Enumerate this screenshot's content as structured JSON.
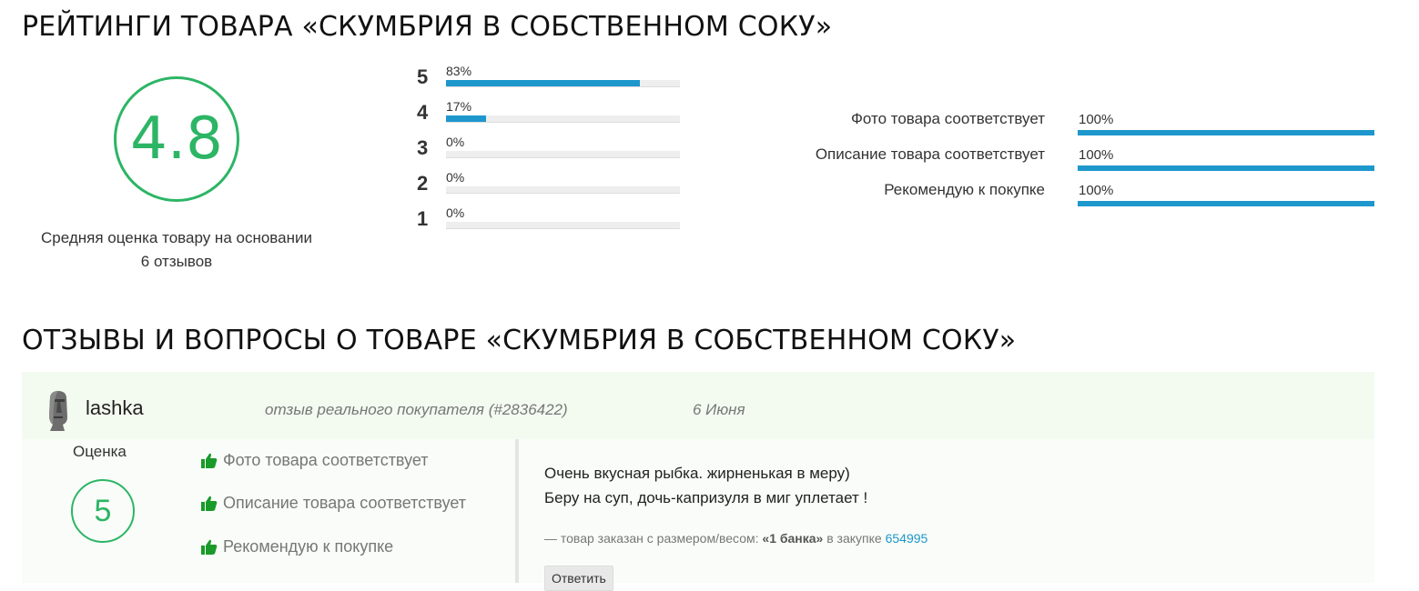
{
  "ratings": {
    "title": "РЕЙТИНГИ ТОВАРА «СКУМБРИЯ В СОБСТВЕННОМ СОКУ»",
    "average": "4.8",
    "caption_line1": "Средняя оценка товару на основании",
    "caption_line2": "6 отзывов",
    "distribution": [
      {
        "star": "5",
        "percent_label": "83%",
        "fraction": 0.83
      },
      {
        "star": "4",
        "percent_label": "17%",
        "fraction": 0.17
      },
      {
        "star": "3",
        "percent_label": "0%",
        "fraction": 0
      },
      {
        "star": "2",
        "percent_label": "0%",
        "fraction": 0
      },
      {
        "star": "1",
        "percent_label": "0%",
        "fraction": 0
      }
    ],
    "criteria": [
      {
        "label": "Фото товара соответствует",
        "percent_label": "100%",
        "fraction": 1.0
      },
      {
        "label": "Описание товара соответствует",
        "percent_label": "100%",
        "fraction": 1.0
      },
      {
        "label": "Рекомендую к покупке",
        "percent_label": "100%",
        "fraction": 1.0
      }
    ]
  },
  "reviews": {
    "title": "ОТЗЫВЫ И ВОПРОСЫ О ТОВАРЕ «СКУМБРИЯ В СОБСТВЕННОМ СОКУ»",
    "items": [
      {
        "username": "lashka",
        "avatar_icon": "moai-statue-avatar",
        "badge_text": "отзыв реального покупателя (#2836422)",
        "date": "6 Июня",
        "rating_label": "Оценка",
        "rating_value": "5",
        "checks": [
          {
            "icon": "thumbs-up-icon",
            "label": "Фото товара соответствует"
          },
          {
            "icon": "thumbs-up-icon",
            "label": "Описание товара соответствует"
          },
          {
            "icon": "thumbs-up-icon",
            "label": "Рекомендую к покупке"
          }
        ],
        "text_line1": "Очень вкусная рыбка. жирненькая в меру)",
        "text_line2": "Беру на суп, дочь-капризуля в миг уплетает !",
        "order_prefix": "—  товар заказан с размером/весом: ",
        "order_size": "«1 банка»",
        "order_middle": " в закупке ",
        "order_link": "654995",
        "reply_label": "Ответить"
      }
    ]
  },
  "colors": {
    "accent_green": "#2cb565",
    "bar_blue": "#1e97cc",
    "thumb_green": "#1a9a2a"
  }
}
